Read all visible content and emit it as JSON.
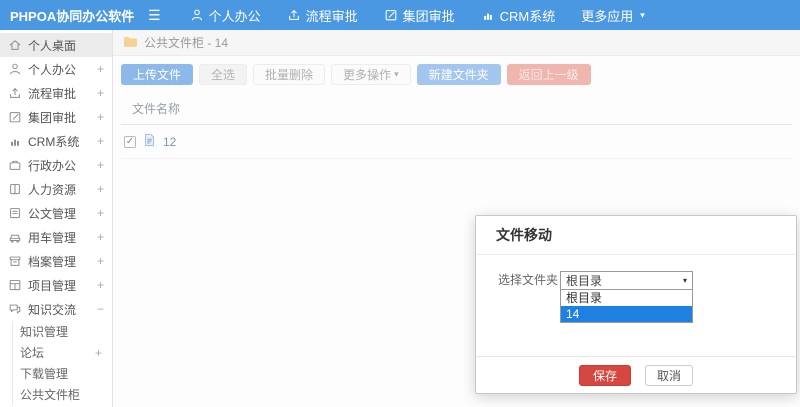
{
  "navbar": {
    "brand": "PHPOA协同办公软件",
    "menu": [
      {
        "label": "个人办公",
        "icon": "user-icon"
      },
      {
        "label": "流程审批",
        "icon": "upload-icon"
      },
      {
        "label": "集团审批",
        "icon": "edit-icon"
      },
      {
        "label": "CRM系统",
        "icon": "bar-chart-icon"
      },
      {
        "label": "更多应用",
        "icon": "caret-down-icon"
      }
    ]
  },
  "sidebar": {
    "items": [
      {
        "label": "个人桌面",
        "expander": "",
        "icon": "home-icon",
        "active": true
      },
      {
        "label": "个人办公",
        "expander": "+",
        "icon": "user-icon"
      },
      {
        "label": "流程审批",
        "expander": "+",
        "icon": "upload-icon"
      },
      {
        "label": "集团审批",
        "expander": "+",
        "icon": "edit-icon"
      },
      {
        "label": "CRM系统",
        "expander": "+",
        "icon": "bar-chart-icon"
      },
      {
        "label": "行政办公",
        "expander": "+",
        "icon": "briefcase-icon"
      },
      {
        "label": "人力资源",
        "expander": "+",
        "icon": "book-icon"
      },
      {
        "label": "公文管理",
        "expander": "+",
        "icon": "document-icon"
      },
      {
        "label": "用车管理",
        "expander": "+",
        "icon": "car-icon"
      },
      {
        "label": "档案管理",
        "expander": "+",
        "icon": "archive-icon"
      },
      {
        "label": "项目管理",
        "expander": "+",
        "icon": "project-icon"
      },
      {
        "label": "知识交流",
        "expander": "−",
        "icon": "chat-icon",
        "expanded": true
      }
    ],
    "subitems": [
      {
        "label": "知识管理",
        "expander": ""
      },
      {
        "label": "论坛",
        "expander": "+"
      },
      {
        "label": "下载管理",
        "expander": ""
      },
      {
        "label": "公共文件柜",
        "expander": ""
      }
    ]
  },
  "breadcrumb": {
    "label": "公共文件柜 - 14"
  },
  "toolbar": {
    "upload": "上传文件",
    "select_all": "全选",
    "batch_delete": "批量删除",
    "more_actions": "更多操作",
    "new_folder": "新建文件夹",
    "back": "返回上一级"
  },
  "file_table": {
    "header": "文件名称",
    "rows": [
      {
        "name": "12",
        "checked": true
      }
    ]
  },
  "modal": {
    "title": "文件移动",
    "field_label": "选择文件夹",
    "selected": "根目录",
    "options": [
      "根目录",
      "14"
    ],
    "highlighted": "14",
    "save": "保存",
    "cancel": "取消"
  },
  "icons": {
    "hamburger": "☰",
    "caret_down": "▾",
    "check": "✓"
  },
  "colors": {
    "navbar": "#4a97e2",
    "upload_button": "#8cb9e9",
    "new_folder_button": "#a3c6ee",
    "back_button": "#efb6af",
    "save_button": "#d6473f",
    "option_highlight": "#1e80e0",
    "folder_icon": "#f3d292"
  }
}
